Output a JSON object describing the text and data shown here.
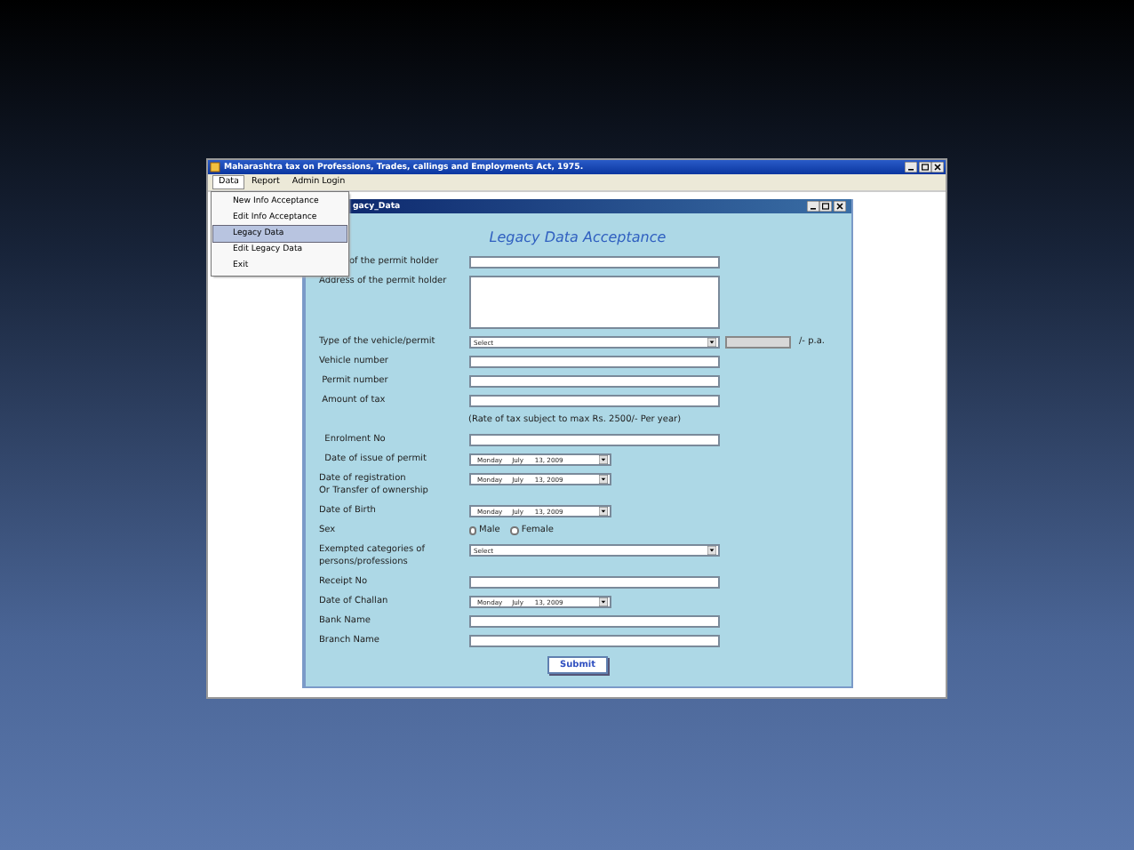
{
  "window": {
    "title": "Maharashtra tax on Professions, Trades, callings and Employments Act, 1975."
  },
  "menu_bar": [
    {
      "label": "Data",
      "selected": true
    },
    {
      "label": "Report",
      "selected": false
    },
    {
      "label": "Admin Login",
      "selected": false
    }
  ],
  "dropdown_menu": [
    {
      "label": "New Info Acceptance",
      "selected": false
    },
    {
      "label": "Edit Info Acceptance",
      "selected": false
    },
    {
      "label": "Legacy Data",
      "selected": true
    },
    {
      "label": "Edit Legacy Data",
      "selected": false
    },
    {
      "label": "Exit",
      "selected": false
    }
  ],
  "child_window": {
    "title": "gacy_Data",
    "heading": "Legacy Data Acceptance"
  },
  "form": [
    {
      "kind": "text",
      "label": "of the permit holder"
    },
    {
      "kind": "textarea",
      "label": "Address of the permit holder"
    },
    {
      "kind": "select",
      "label": "Type of the vehicle/permit",
      "value": "Select",
      "suffix": "/- p.a."
    },
    {
      "kind": "text",
      "label": "Vehicle number"
    },
    {
      "kind": "text",
      "label": " Permit number"
    },
    {
      "kind": "text",
      "label": " Amount of tax"
    },
    {
      "kind": "note",
      "text": "(Rate of tax subject to max Rs. 2500/- Per year)"
    },
    {
      "kind": "text",
      "label": "  Enrolment No"
    },
    {
      "kind": "date",
      "label": "  Date of issue of permit",
      "day": "Monday",
      "month": "July",
      "date": "13, 2009"
    },
    {
      "kind": "date",
      "label": "Date of registration\nOr Transfer of ownership",
      "day": "Monday",
      "month": "July",
      "date": "13, 2009"
    },
    {
      "kind": "date",
      "label": "Date of Birth",
      "day": "Monday",
      "month": "July",
      "date": "13, 2009"
    },
    {
      "kind": "radio",
      "label": "Sex",
      "options": [
        {
          "label": "Male",
          "selected": false
        },
        {
          "label": "Female",
          "selected": false
        }
      ]
    },
    {
      "kind": "select",
      "label": "Exempted categories of\npersons/professions",
      "value": "Select"
    },
    {
      "kind": "text",
      "label": "Receipt No"
    },
    {
      "kind": "date",
      "label": "Date of Challan",
      "day": "Monday",
      "month": "July",
      "date": "13, 2009"
    },
    {
      "kind": "text",
      "label": "Bank Name"
    },
    {
      "kind": "text",
      "label": "Branch Name"
    }
  ],
  "submit": "Submit"
}
